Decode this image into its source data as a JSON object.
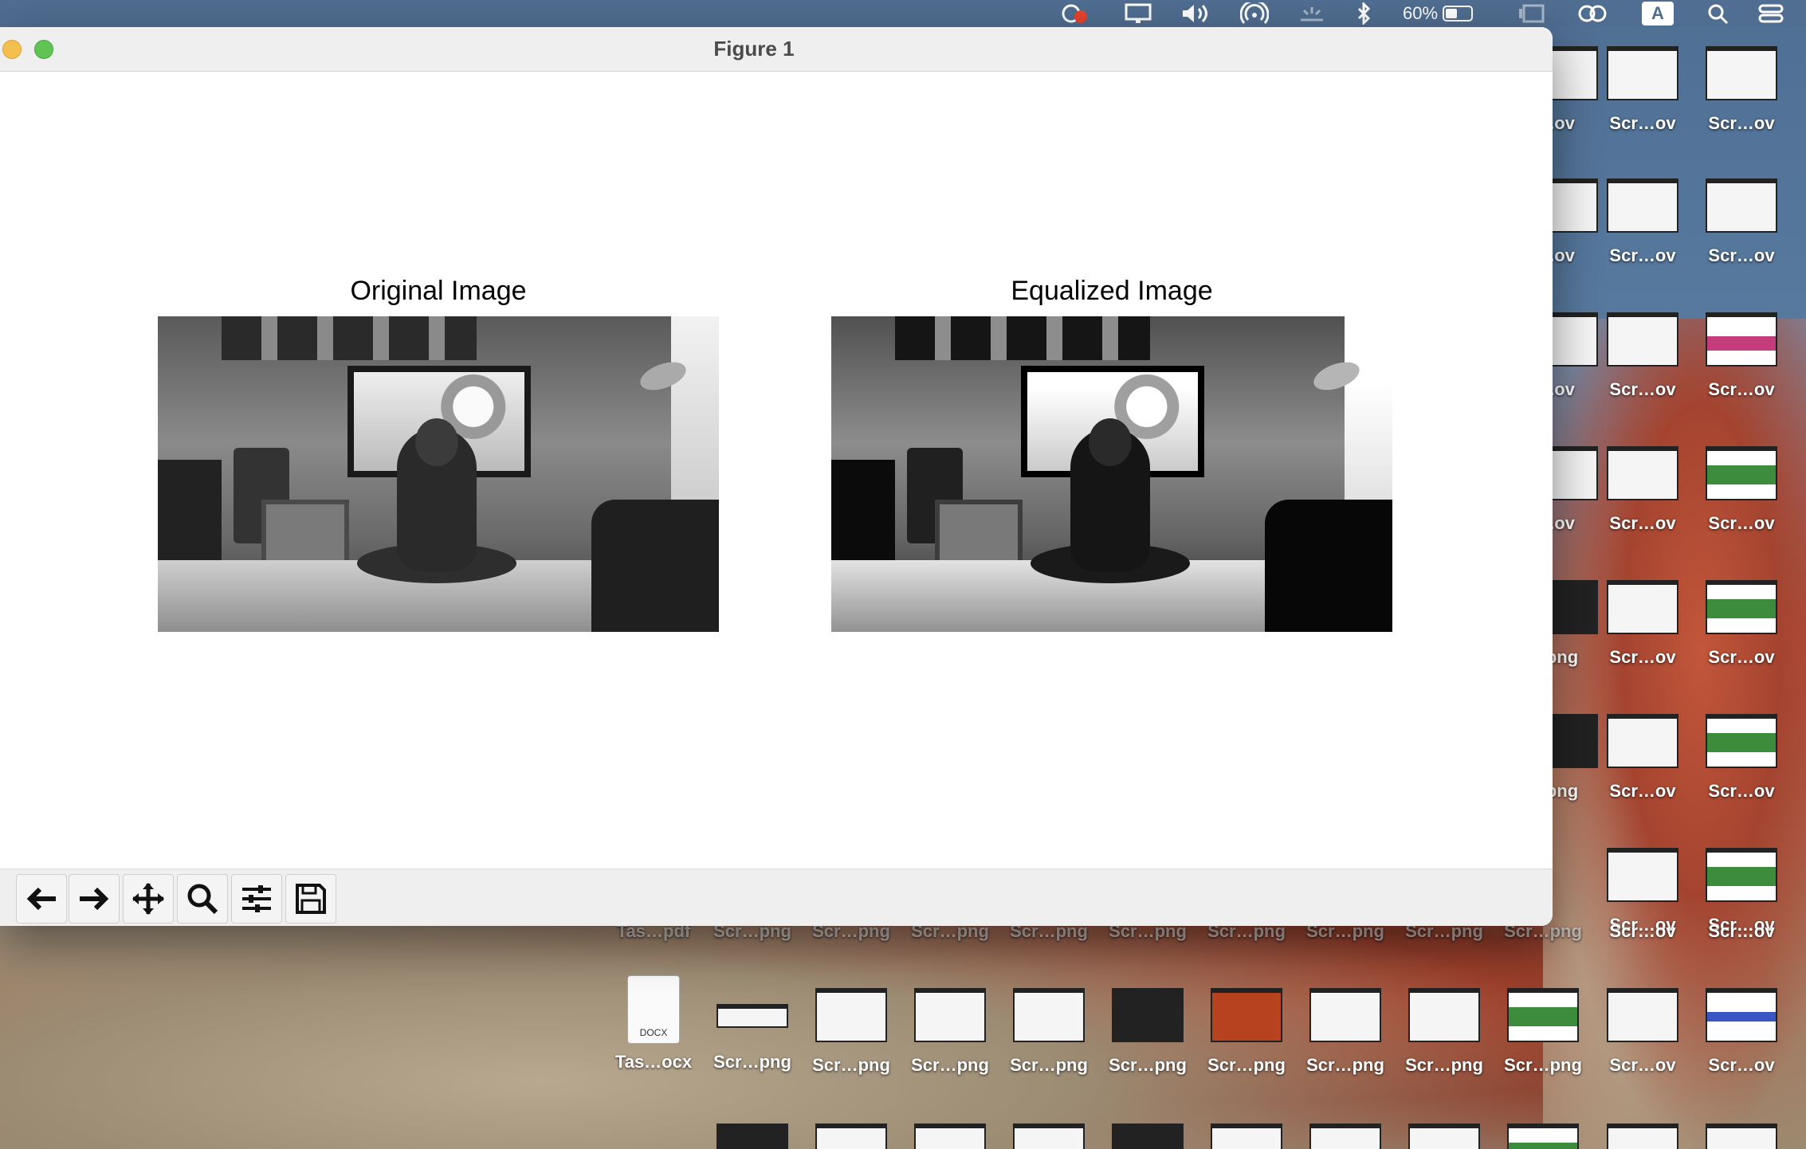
{
  "menubar": {
    "battery_percent": "60%",
    "input_source": "A"
  },
  "window": {
    "title": "Figure 1"
  },
  "figure": {
    "left_title": "Original Image",
    "right_title": "Equalized Image"
  },
  "toolbar": {
    "icons": [
      "back-icon",
      "forward-icon",
      "pan-icon",
      "zoom-icon",
      "configure-subplots-icon",
      "save-icon"
    ]
  },
  "desktop": {
    "right_col1_labels": [
      ".ov",
      ".ov",
      ".ov",
      ".ov",
      "png",
      "png"
    ],
    "right_col2_labels": [
      "Scr…ov",
      "Scr…ov",
      "Scr…ov",
      "Scr…ov",
      "Scr…ov",
      "Scr…ov",
      "Scr…ov"
    ],
    "right_col3_labels": [
      "Scr…ov",
      "Scr…ov",
      "Scr…ov",
      "Scr…ov",
      "Scr…ov",
      "Scr…ov",
      "Scr…ov"
    ],
    "row1_labels": [
      "Tas…pdf",
      "Scr…png",
      "Scr…png",
      "Scr…png",
      "Scr…png",
      "Scr…png",
      "Scr…png",
      "Scr…png",
      "Scr…png",
      "Scr…png",
      "Scr…ov",
      "Scr…ov"
    ],
    "row2_labels": [
      "Tas…ocx",
      "Scr…png",
      "Scr…png",
      "Scr…png",
      "Scr…png",
      "Scr…png",
      "Scr…png",
      "Scr…png",
      "Scr…png",
      "Scr…png",
      "Scr…ov",
      "Scr…ov"
    ],
    "docx_badge": "DOCX"
  }
}
